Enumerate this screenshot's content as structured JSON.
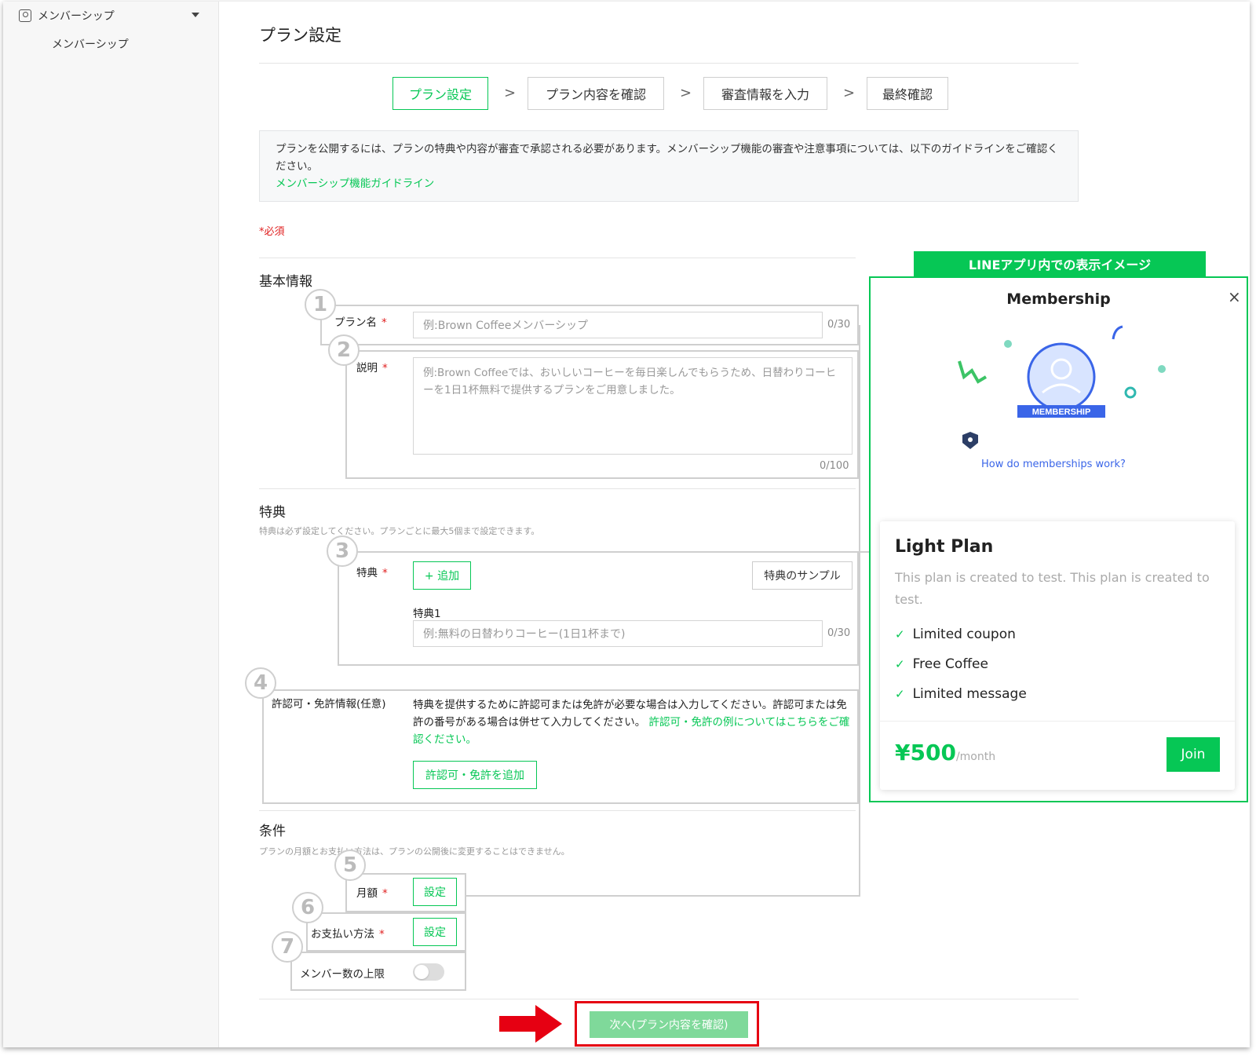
{
  "sidebar": {
    "section": "メンバーシップ",
    "item": "メンバーシップ"
  },
  "page": {
    "title": "プラン設定"
  },
  "steps": [
    "プラン設定",
    "プラン内容を確認",
    "審査情報を入力",
    "最終確認"
  ],
  "notice": {
    "text": "プランを公開するには、プランの特典や内容が審査で承認される必要があります。メンバーシップ機能の審査や注意事項については、以下のガイドラインをご確認ください。",
    "link": "メンバーシップ機能ガイドライン"
  },
  "required_note": "*必須",
  "basic": {
    "title": "基本情報",
    "plan_name_label": "プラン名",
    "plan_name_placeholder": "例:Brown Coffeeメンバーシップ",
    "plan_name_count": "0/30",
    "desc_label": "説明",
    "desc_placeholder": "例:Brown Coffeeでは、おいしいコーヒーを毎日楽しんでもらうため、日替わりコーヒーを1日1杯無料で提供するプランをご用意しました。",
    "desc_count": "0/100"
  },
  "benefits": {
    "title": "特典",
    "desc": "特典は必ず設定してください。プランごとに最大5個まで設定できます。",
    "label": "特典",
    "add_button": "+ 追加",
    "sample_button": "特典のサンプル",
    "item_label": "特典1",
    "item_placeholder": "例:無料の日替わりコーヒー(1日1杯まで)",
    "item_count": "0/30"
  },
  "license": {
    "label": "許認可・免許情報(任意)",
    "text": "特典を提供するために許認可または免許が必要な場合は入力してください。許認可または免許の番号がある場合は併せて入力してください。",
    "link": "許認可・免許の例についてはこちらをご確認ください。",
    "add_button": "許認可・免許を追加"
  },
  "conditions": {
    "title": "条件",
    "desc": "プランの月額とお支払い方法は、プランの公開後に変更することはできません。",
    "monthly_label": "月額",
    "payment_label": "お支払い方法",
    "set_button": "設定",
    "limit_label": "メンバー数の上限"
  },
  "callout_numbers": [
    "1",
    "2",
    "3",
    "4",
    "5",
    "6",
    "7"
  ],
  "preview": {
    "tag": "LINEアプリ内での表示イメージ",
    "header": "Membership",
    "badge": "MEMBERSHIP",
    "how_link": "How do memberships work?",
    "plan_name": "Light Plan",
    "plan_desc": "This plan is created to test. This plan is created to test.",
    "features": [
      "Limited coupon",
      "Free Coffee",
      "Limited message"
    ],
    "price": "¥500",
    "per": "/month",
    "join": "Join"
  },
  "next_button": "次へ(プラン内容を確認)",
  "colors": {
    "accent": "#06c755",
    "required": "#e02020",
    "highlight": "#e60012"
  }
}
